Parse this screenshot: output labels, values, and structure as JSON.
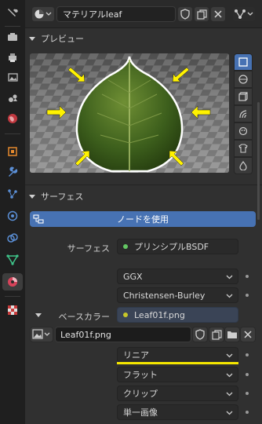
{
  "header": {
    "material_name": "マテリアルleaf"
  },
  "preview": {
    "title": "プレビュー"
  },
  "surface_panel": {
    "title": "サーフェス",
    "use_nodes_label": "ノードを使用",
    "surface_label": "サーフェス",
    "surface_value": "プリンシプルBSDF",
    "distribution": "GGX",
    "subsurface_method": "Christensen-Burley",
    "base_color_label": "ベースカラー",
    "base_color_value": "Leaf01f.png",
    "image_name": "Leaf01f.png",
    "interpolation": "リニア",
    "projection": "フラット",
    "extension": "クリップ",
    "source": "単一画像"
  },
  "colors": {
    "accent_blue": "#4772b3",
    "highlight_yellow": "#f5e600",
    "socket_green": "#63c763",
    "socket_yellow": "#c7c729"
  }
}
